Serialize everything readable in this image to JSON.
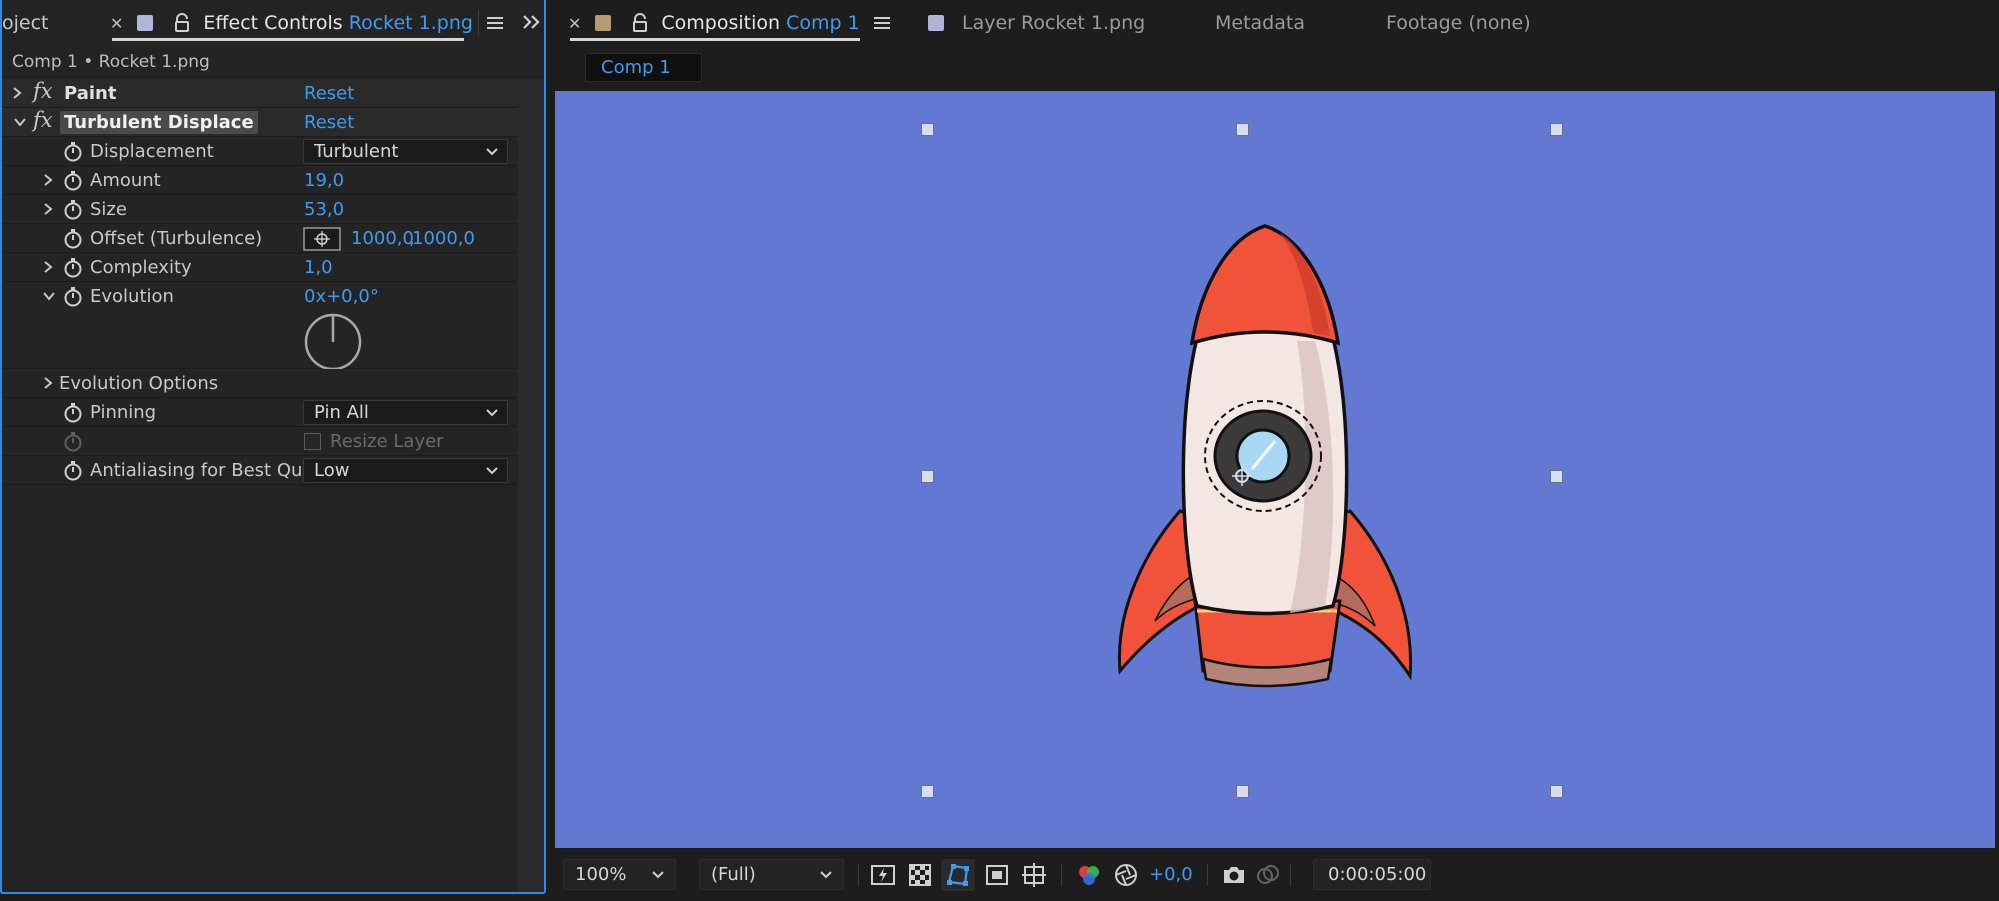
{
  "left_panel": {
    "tabs": {
      "project_label": "oject",
      "effect_controls_label": "Effect Controls",
      "effect_controls_target": "Rocket 1.png"
    },
    "breadcrumb": "Comp 1 • Rocket 1.png",
    "effects": {
      "paint": {
        "name": "Paint",
        "reset": "Reset"
      },
      "turbulent": {
        "name": "Turbulent Displace",
        "reset": "Reset",
        "displacement": {
          "label": "Displacement",
          "value": "Turbulent"
        },
        "amount": {
          "label": "Amount",
          "value": "19,0"
        },
        "size": {
          "label": "Size",
          "value": "53,0"
        },
        "offset": {
          "label": "Offset (Turbulence)",
          "x": "1000,0",
          "y": "1000,0"
        },
        "complexity": {
          "label": "Complexity",
          "value": "1,0"
        },
        "evolution": {
          "label": "Evolution",
          "value": "0x+0,0°"
        },
        "evolution_options": {
          "label": "Evolution Options"
        },
        "pinning": {
          "label": "Pinning",
          "value": "Pin All"
        },
        "resize_layer": {
          "label": "Resize Layer",
          "checked": false
        },
        "antialiasing": {
          "label": "Antialiasing for Best Qua",
          "value": "Low"
        }
      }
    }
  },
  "viewer": {
    "tabs": {
      "composition_label": "Composition",
      "composition_target": "Comp 1",
      "layer_label": "Layer",
      "layer_target": "Rocket 1.png",
      "metadata_label": "Metadata",
      "footage_label": "Footage (none)"
    },
    "comp_chip": "Comp 1",
    "canvas_color": "#6278d3",
    "bottom_bar": {
      "zoom": "100%",
      "resolution": "(Full)",
      "exposure": "+0,0",
      "timecode": "0:00:05:00"
    }
  },
  "colors": {
    "accent": "#3c9cf0",
    "panel_border": "#2d8ceb",
    "ec_swatch": "#b3b3dc",
    "comp_swatch": "#b69a74",
    "layer_swatch": "#b0b0d8"
  }
}
